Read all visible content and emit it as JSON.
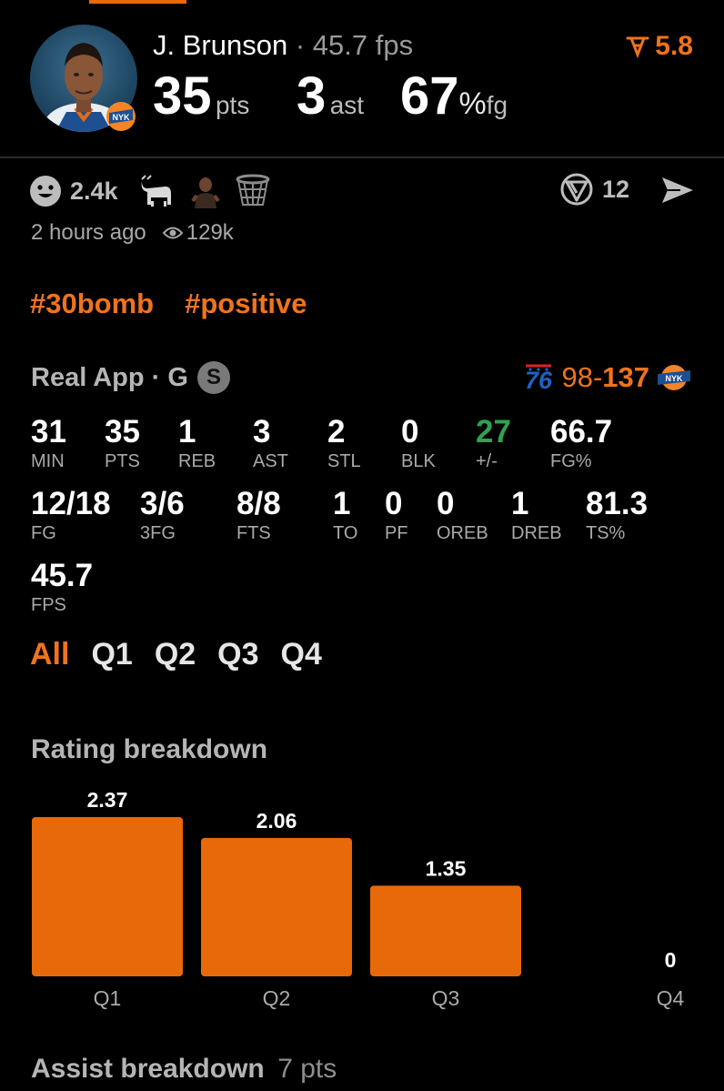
{
  "player": {
    "name": "J. Brunson",
    "separator": "·",
    "fps": "45.7 fps",
    "pts": "35",
    "pts_unit": "pts",
    "ast": "3",
    "ast_unit": "ast",
    "fg": "67",
    "fg_percent": "%",
    "fg_unit": "fg",
    "rating": "5.8"
  },
  "reactions": {
    "smile_count": "2.4k",
    "comment_count": "12",
    "icons": [
      "smile-icon",
      "goat-icon",
      "player-emoji-icon",
      "basketball-hoop-icon",
      "comment-icon",
      "send-icon"
    ]
  },
  "meta": {
    "time": "2 hours ago",
    "views": "129k"
  },
  "tags": [
    "#30bomb",
    "#positive"
  ],
  "game": {
    "source": "Real App · G",
    "badge": "S",
    "away_score": "98",
    "dash": "-",
    "home_score": "137"
  },
  "stats": [
    {
      "value": "31",
      "label": "MIN"
    },
    {
      "value": "35",
      "label": "PTS"
    },
    {
      "value": "1",
      "label": "REB"
    },
    {
      "value": "3",
      "label": "AST"
    },
    {
      "value": "2",
      "label": "STL"
    },
    {
      "value": "0",
      "label": "BLK"
    },
    {
      "value": "27",
      "label": "+/-"
    },
    {
      "value": "66.7",
      "label": "FG%"
    },
    {
      "value": "12/18",
      "label": "FG"
    },
    {
      "value": "3/6",
      "label": "3FG"
    },
    {
      "value": "8/8",
      "label": "FTS"
    },
    {
      "value": "1",
      "label": "TO"
    },
    {
      "value": "0",
      "label": "PF"
    },
    {
      "value": "0",
      "label": "OREB"
    },
    {
      "value": "1",
      "label": "DREB"
    },
    {
      "value": "81.3",
      "label": "TS%"
    },
    {
      "value": "45.7",
      "label": "FPS"
    }
  ],
  "quarter_tabs": [
    "All",
    "Q1",
    "Q2",
    "Q3",
    "Q4"
  ],
  "active_tab": "All",
  "rating_title": "Rating breakdown",
  "chart_data": {
    "type": "bar",
    "categories": [
      "Q1",
      "Q2",
      "Q3",
      "Q4"
    ],
    "values": [
      2.37,
      2.06,
      1.35,
      0
    ],
    "data_labels": [
      "2.37",
      "2.06",
      "1.35",
      "0"
    ],
    "title": "Rating breakdown",
    "ylim": [
      0,
      2.37
    ],
    "grid": false,
    "color": "#e8690a"
  },
  "assist": {
    "title": "Assist breakdown",
    "value": "7 pts"
  },
  "colors": {
    "accent": "#f0731c",
    "bar": "#e8690a",
    "positive": "#2fa24e",
    "background": "#000000"
  }
}
